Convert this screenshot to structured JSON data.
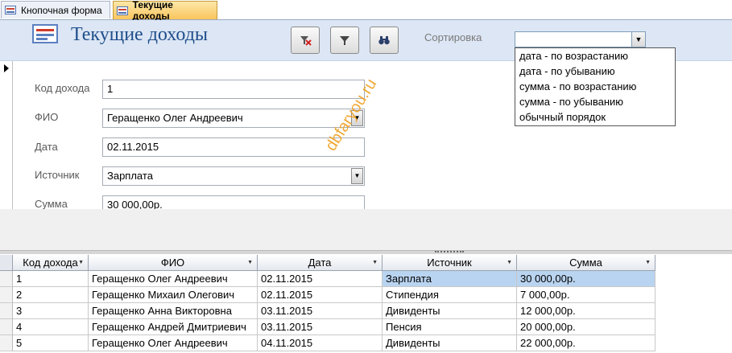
{
  "tabs": [
    {
      "label": "Кнопочная форма",
      "active": false
    },
    {
      "label": "Текущие доходы",
      "active": true
    }
  ],
  "header": {
    "title": "Текущие доходы",
    "sort_label": "Сортировка",
    "sort_value": "",
    "buttons": [
      {
        "icon": "remove-filter-icon"
      },
      {
        "icon": "filter-icon"
      },
      {
        "icon": "find-binoculars-icon"
      }
    ]
  },
  "sort_options": [
    "дата - по возрастанию",
    "дата - по убыванию",
    "сумма - по возрастанию",
    "сумма - по убыванию",
    "обычный порядок"
  ],
  "form": {
    "code_label": "Код дохода",
    "code_value": "1",
    "fio_label": "ФИО",
    "fio_value": "Геращенко Олег Андреевич",
    "date_label": "Дата",
    "date_value": "02.11.2015",
    "source_label": "Источник",
    "source_value": "Зарплата",
    "sum_label": "Сумма",
    "sum_value": "30 000,00р."
  },
  "watermark": "dbfaryou.ru",
  "datasheet": {
    "columns": [
      "Код дохода",
      "ФИО",
      "Дата",
      "Источник",
      "Сумма"
    ],
    "rows": [
      [
        "1",
        "Геращенко Олег Андреевич",
        "02.11.2015",
        "Зарплата",
        "30 000,00р."
      ],
      [
        "2",
        "Геращенко Михаил Олегович",
        "02.11.2015",
        "Стипендия",
        "7 000,00р."
      ],
      [
        "3",
        "Геращенко Анна Викторовна",
        "03.11.2015",
        "Дивиденты",
        "12 000,00р."
      ],
      [
        "4",
        "Геращенко Андрей Дмитриевич",
        "03.11.2015",
        "Пенсия",
        "20 000,00р."
      ],
      [
        "5",
        "Геращенко Олег Андреевич",
        "04.11.2015",
        "Дивиденты",
        "22 000,00р."
      ]
    ]
  },
  "colors": {
    "accent": "#1f4e8c",
    "selected_row": "#b9d4f0",
    "active_tab": "#f9c55d"
  }
}
